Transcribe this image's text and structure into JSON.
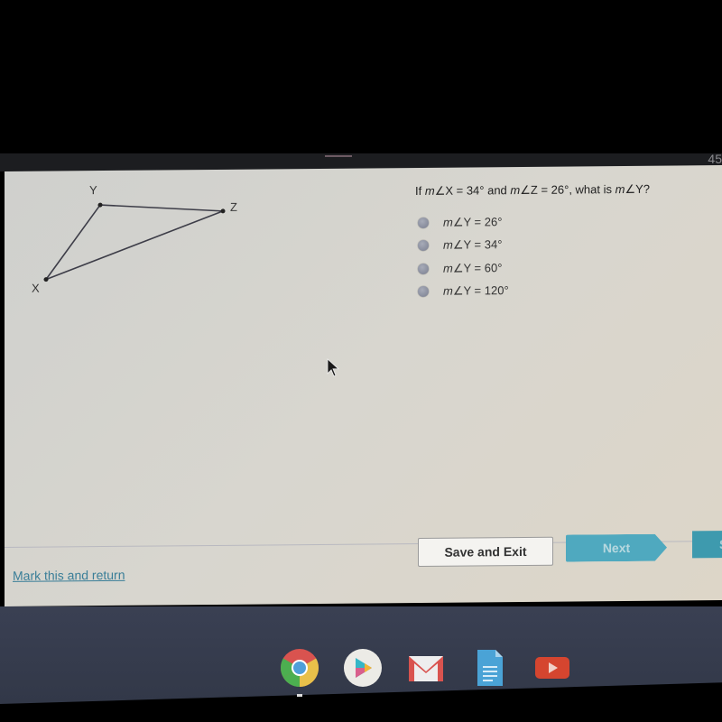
{
  "topbar": {
    "timer_partial": "45"
  },
  "figure": {
    "vertices": [
      {
        "label": "X"
      },
      {
        "label": "Y"
      },
      {
        "label": "Z"
      }
    ]
  },
  "question": {
    "prefix": "If ",
    "m1": "m",
    "part1": "∠X = 34° and ",
    "m2": "m",
    "part2": "∠Z = 26°, what is ",
    "m3": "m",
    "part3": "∠Y?"
  },
  "options": [
    {
      "m": "m",
      "text": "∠Y = 26°"
    },
    {
      "m": "m",
      "text": "∠Y = 34°"
    },
    {
      "m": "m",
      "text": "∠Y = 60°"
    },
    {
      "m": "m",
      "text": "∠Y = 120°"
    }
  ],
  "footer": {
    "mark_link": "Mark this and return",
    "save_exit": "Save and Exit",
    "next": "Next",
    "submit_partial": "S"
  },
  "shelf": {
    "apps": [
      "chrome-icon",
      "play-store-icon",
      "gmail-icon",
      "docs-icon",
      "youtube-icon"
    ]
  }
}
